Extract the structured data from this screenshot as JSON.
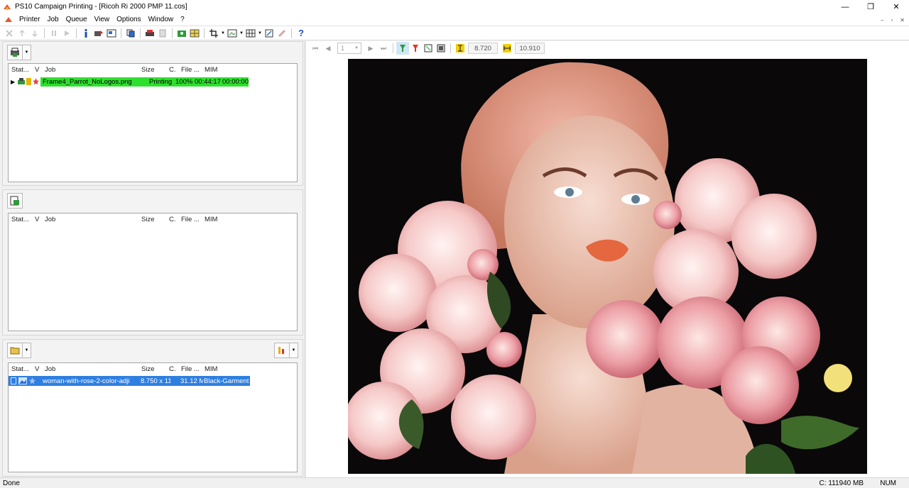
{
  "window": {
    "title": "PS10 Campaign Printing - [Ricoh Ri 2000 PMP 11.cos]",
    "minimize": "—",
    "maximize": "❐",
    "close": "✕"
  },
  "menu": [
    "Printer",
    "Job",
    "Queue",
    "View",
    "Options",
    "Window",
    "?"
  ],
  "mdi": {
    "minimize": "–",
    "restore": "▫",
    "close": "✕"
  },
  "toolbar": {
    "icons": [
      "cancel-icon",
      "move-up-icon",
      "move-down-icon",
      "pause-icon",
      "play-icon",
      "info-icon",
      "send-icon",
      "layout-icon",
      "copy-icon",
      "print-icon",
      "delete-icon",
      "color-icon",
      "nest-icon",
      "crop-icon",
      "tile-icon",
      "grid-icon",
      "resize-icon",
      "erase-icon",
      "help-icon"
    ],
    "help_label": "?"
  },
  "columns": [
    "Stat...",
    "V",
    "Job",
    "Size",
    "C.",
    "File ...",
    "MIM"
  ],
  "print_queue": {
    "rows": [
      {
        "job": "Frame4_Parrot_NoLogos.png",
        "status": "Printing",
        "progress": "100%",
        "time1": "00:44:17",
        "time2": "00:00:00",
        "highlight": "#2ee02e"
      }
    ]
  },
  "hold_queue": {
    "rows": []
  },
  "job_list": {
    "rows": [
      {
        "job": "woman-with-rose-2-color-adji",
        "size": "8.750 x 11",
        "file": "31.12 M",
        "mim": "Black-Garment",
        "highlight": "#2f7fe0"
      }
    ]
  },
  "preview": {
    "page_number": "1",
    "height_value": "8.720",
    "width_value": "10.910"
  },
  "status": {
    "left": "Done",
    "memory": "C: 111940 MB",
    "num": "NUM"
  },
  "colors": {
    "accent_green": "#2ee02e",
    "selection_blue": "#2f7fe0"
  }
}
